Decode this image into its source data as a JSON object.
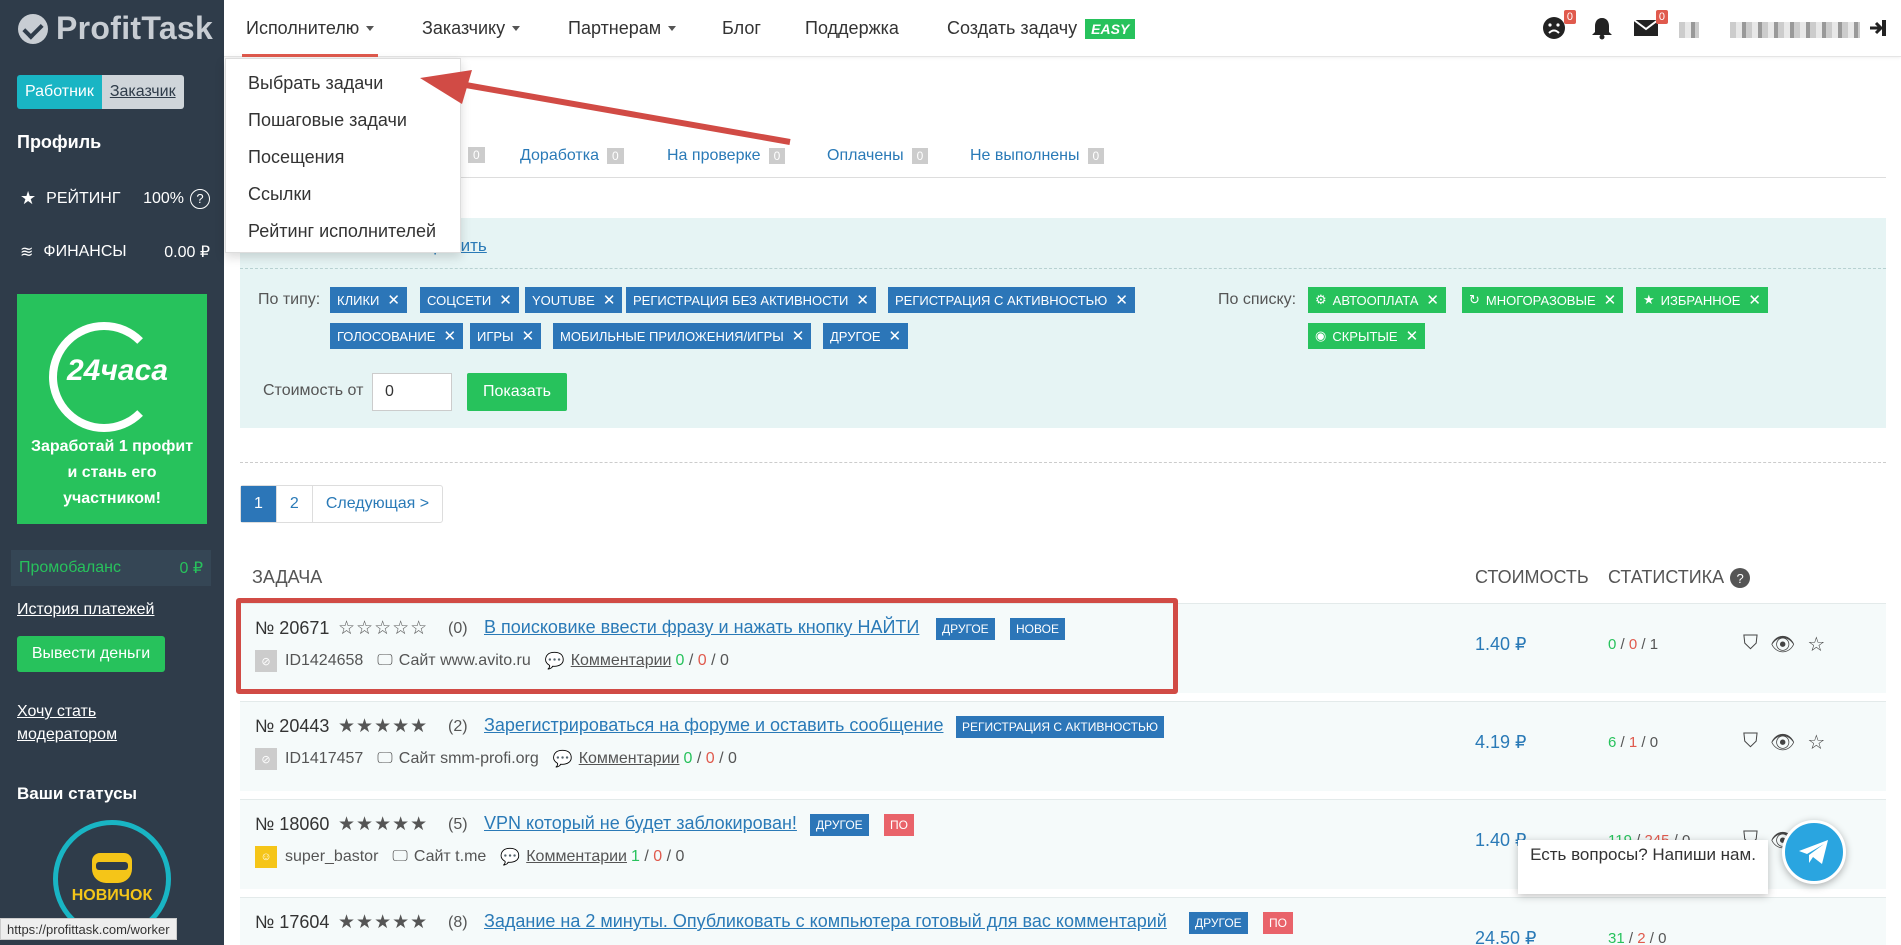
{
  "sidebar": {
    "logo": "ProfitTask",
    "role_worker": "Работник",
    "role_customer": "Заказчик",
    "profile_title": "Профиль",
    "rating_label": "РЕЙТИНГ",
    "rating_value": "100%",
    "finance_label": "ФИНАНСЫ",
    "finance_value": "0.00 ₽",
    "promo_circle": "24часа",
    "promo_text": "Заработай 1 профит и стань его участником!",
    "promobalance_label": "Промобаланс",
    "promobalance_value": "0 ₽",
    "payment_history": "История платежей",
    "withdraw": "Вывести деньги",
    "moderator_link": "Хочу стать модератором",
    "statuses_title": "Ваши статусы",
    "status_badge": "НОВИЧОК"
  },
  "statusbar": "https://profittask.com/worker",
  "nav": {
    "items": [
      "Исполнителю",
      "Заказчику",
      "Партнерам",
      "Блог",
      "Поддержка",
      "Создать задачу"
    ],
    "easy": "EASY",
    "counters": {
      "face": "0",
      "mail": "0"
    }
  },
  "dropdown": [
    "Выбрать задачи",
    "Пошаговые задачи",
    "Посещения",
    "Ссылки",
    "Рейтинг исполнителей"
  ],
  "tabs": [
    {
      "label": "",
      "count": "0"
    },
    {
      "label": "Доработка",
      "count": "0"
    },
    {
      "label": "На проверке",
      "count": "0"
    },
    {
      "label": "Оплачены",
      "count": "0"
    },
    {
      "label": "Не выполнены",
      "count": "0"
    }
  ],
  "filter": {
    "reset": "сбросить",
    "by_type": "По типу:",
    "by_list": "По списку:",
    "type_tags": [
      "клики",
      "соцсети",
      "youtube",
      "регистрация без активности",
      "регистрация с активностью",
      "голосование",
      "игры",
      "мобильные приложения/игры",
      "другое"
    ],
    "list_tags": [
      "автооплата",
      "многоразовые",
      "избранное",
      "скрытые"
    ],
    "cost_from": "Стоимость от",
    "cost_value": "0",
    "show": "Показать"
  },
  "pagination": [
    "1",
    "2",
    "Следующая >"
  ],
  "table": {
    "col_task": "Задача",
    "col_cost": "Стоимость",
    "col_stats": "Статистика"
  },
  "tasks": [
    {
      "num": "№ 20671",
      "stars": "☆☆☆☆☆",
      "rating": "(0)",
      "title": "В поисковике ввести фразу и нажать кнопку НАЙТИ",
      "badges": [
        "другое",
        "новое"
      ],
      "author": "ID1424658",
      "site": "Сайт www.avito.ru",
      "comments": "Комментарии",
      "c1": "0",
      "c2": "0",
      "c3": "0",
      "price": "1.40 ₽",
      "s1": "0",
      "s2": "0",
      "s3": "1"
    },
    {
      "num": "№ 20443",
      "stars": "★★★★★",
      "rating": "(2)",
      "title": "Зарегистрироваться на форуме и оставить сообщение",
      "badges": [
        "регистрация с активностью"
      ],
      "author": "ID1417457",
      "site": "Сайт smm-profi.org",
      "comments": "Комментарии",
      "c1": "0",
      "c2": "0",
      "c3": "0",
      "price": "4.19 ₽",
      "s1": "6",
      "s2": "1",
      "s3": "0"
    },
    {
      "num": "№ 18060",
      "stars": "★★★★★",
      "rating": "(5)",
      "title": "VPN который не будет заблокирован!",
      "badges": [
        "другое",
        "по"
      ],
      "author": "super_bastor",
      "site": "Сайт t.me",
      "comments": "Комментарии",
      "c1": "1",
      "c2": "0",
      "c3": "0",
      "price": "1.40 ₽",
      "s1": "119",
      "s2": "245",
      "s3": "0"
    },
    {
      "num": "№ 17604",
      "stars": "★★★★★",
      "rating": "(8)",
      "title": "Задание на 2 минуты. Опубликовать с компьютера готовый для вас комментарий",
      "badges": [
        "другое",
        "по"
      ],
      "author": "",
      "site": "",
      "comments": "",
      "c1": "",
      "c2": "",
      "c3": "",
      "price": "24.50 ₽",
      "s1": "31",
      "s2": "2",
      "s3": "0"
    }
  ],
  "chat": {
    "text": "Есть вопросы? Напиши нам."
  },
  "colors": {
    "sidebar": "#2f3c4a",
    "accent_green": "#27c25c",
    "accent_blue": "#2c76b8",
    "accent_red": "#e05a4d"
  }
}
